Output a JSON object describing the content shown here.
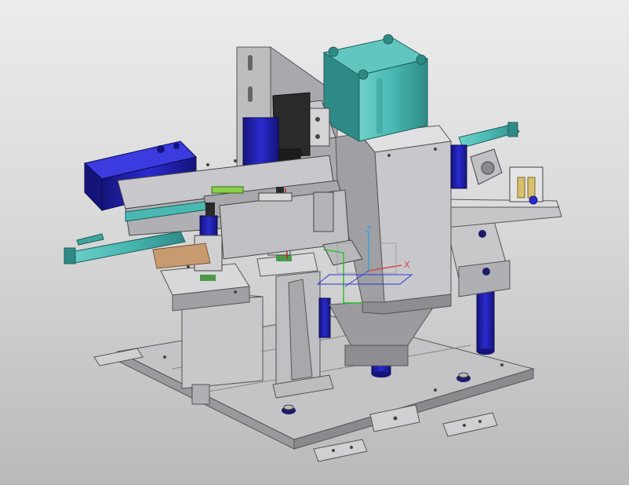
{
  "viewport": {
    "background_top": "#ececec",
    "background_bottom": "#b9b9b9",
    "model": "automation-fixture-assembly"
  },
  "triad": {
    "x_label": "X",
    "y_label": "Y",
    "z_label": "Z",
    "x_color": "#d04a4a",
    "y_color": "#2a3ad0",
    "z_color": "#3aa0d0"
  },
  "colors": {
    "steel": "#b4b4b6",
    "steel_dark": "#7e7e82",
    "steel_light": "#dcdcde",
    "teal": "#49b8b2",
    "teal_dark": "#2e8a86",
    "blue": "#2a2ad0",
    "blue_dark": "#14147a",
    "black": "#2a2a2a"
  }
}
